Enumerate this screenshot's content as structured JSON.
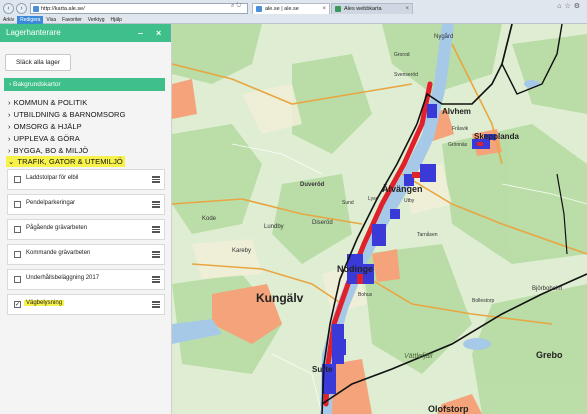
{
  "browser": {
    "url": "http://karta.ale.se/",
    "tabs": [
      {
        "label": "ale.se | ale.se",
        "color": "#4a90d9"
      },
      {
        "label": "Ales webbkarta",
        "color": "#3a9a5c"
      }
    ],
    "menu": [
      "Arkiv",
      "Redigera",
      "Visa",
      "Favoriter",
      "Verktyg",
      "Hjälp"
    ],
    "icons": [
      "search-icon",
      "refresh-icon",
      "home-icon",
      "star-icon",
      "gear-icon"
    ]
  },
  "panel": {
    "title": "Lagerhanterare",
    "hide_all": "Släck alla lager",
    "background_maps": "Bakgrundskartor",
    "categories": [
      {
        "label": "KOMMUN & POLITIK"
      },
      {
        "label": "UTBILDNING & BARNOMSORG"
      },
      {
        "label": "OMSORG & HJÄLP"
      },
      {
        "label": "UPPLEVA & GÖRA"
      },
      {
        "label": "BYGGA, BO & MILJÖ"
      },
      {
        "label": "TRAFIK, GATOR & UTEMILJÖ"
      }
    ],
    "layers": [
      {
        "label": "Laddstolpar för elbil",
        "checked": false
      },
      {
        "label": "Pendelparkeringar",
        "checked": false
      },
      {
        "label": "Pågående grävarbeten",
        "checked": false
      },
      {
        "label": "Kommande grävarbeten",
        "checked": false
      },
      {
        "label": "Underhållsbeläggning 2017",
        "checked": false
      },
      {
        "label": "Vägbelysning",
        "checked": true
      }
    ],
    "check_glyph": "✓"
  },
  "map": {
    "places": [
      "Nygård",
      "Grorod",
      "Svenseröd",
      "Alvhem",
      "Skepplanda",
      "Fråsvik",
      "Grönnäs",
      "Duveröd",
      "Sund",
      "Älvängen",
      "Utby",
      "Lyse",
      "Tarnåsen",
      "Kode",
      "Lundby",
      "Diseröd",
      "Kareby",
      "Nödinge",
      "Kungälv",
      "Bohus",
      "Surte",
      "Grebo",
      "Björboholm",
      "Olofstorp",
      "Vättlefjäll",
      "Bollestorp"
    ],
    "colors": {
      "water": "#a7c9e8",
      "forest": "#bfe0ad",
      "urban": "#f3a173",
      "lights_red": "#e0202a",
      "lights_blue": "#3a3ad8",
      "border": "#111111"
    }
  }
}
